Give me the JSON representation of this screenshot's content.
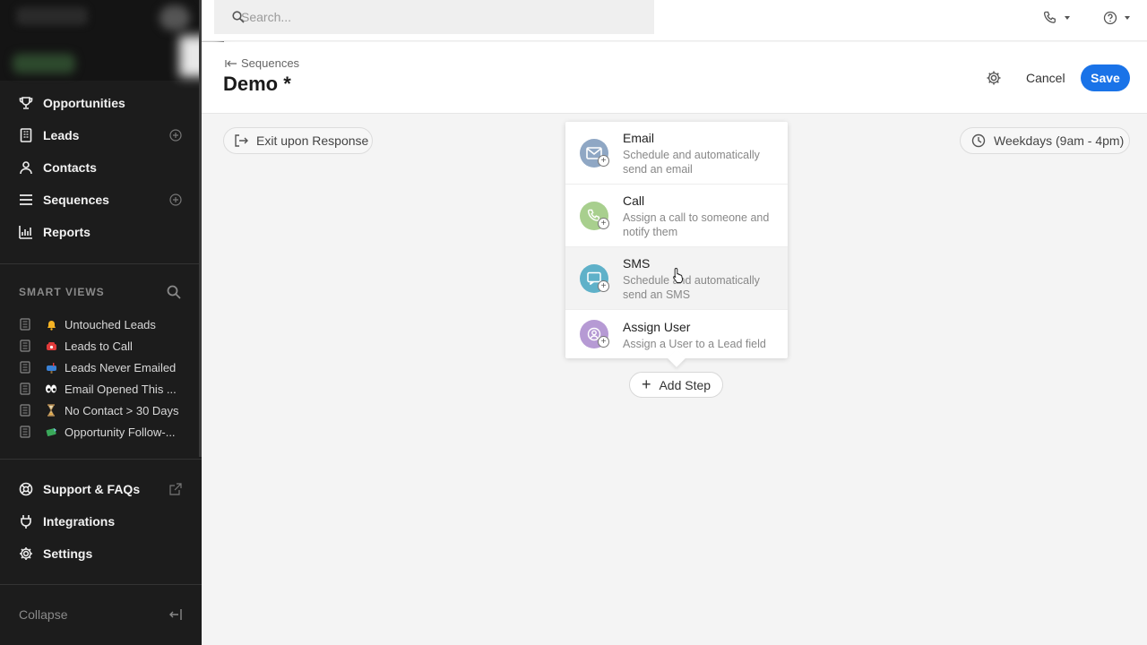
{
  "sidebar": {
    "nav_top": [
      {
        "label": "Opportunities",
        "icon": "trophy-icon"
      },
      {
        "label": "Leads",
        "icon": "building-icon",
        "add": true
      },
      {
        "label": "Contacts",
        "icon": "person-icon"
      },
      {
        "label": "Sequences",
        "icon": "list-icon",
        "add": true
      },
      {
        "label": "Reports",
        "icon": "chart-icon"
      }
    ],
    "smart_views_label": "SMART VIEWS",
    "smart_views": [
      {
        "label": "Untouched Leads",
        "emoji": "bell"
      },
      {
        "label": "Leads to Call",
        "emoji": "phone"
      },
      {
        "label": "Leads Never Emailed",
        "emoji": "mailbox"
      },
      {
        "label": "Email Opened This ...",
        "emoji": "eyes"
      },
      {
        "label": "No Contact > 30 Days",
        "emoji": "hourglass"
      },
      {
        "label": "Opportunity Follow-...",
        "emoji": "money"
      }
    ],
    "nav_bottom": [
      {
        "label": "Support & FAQs",
        "icon": "lifebuoy-icon"
      },
      {
        "label": "Integrations",
        "icon": "plug-icon"
      },
      {
        "label": "Settings",
        "icon": "gear-icon"
      }
    ],
    "collapse_label": "Collapse"
  },
  "topbar": {
    "search_placeholder": "Search..."
  },
  "header": {
    "breadcrumb": "Sequences",
    "title": "Demo *",
    "cancel_label": "Cancel",
    "save_label": "Save"
  },
  "canvas": {
    "exit_label": "Exit upon Response",
    "schedule_label": "Weekdays (9am - 4pm)",
    "add_step_label": "Add Step",
    "step_options": [
      {
        "title": "Email",
        "desc": "Schedule and automatically send an email",
        "color": "#8fa7c4"
      },
      {
        "title": "Call",
        "desc": "Assign a call to someone and notify them",
        "color": "#a8cf8e"
      },
      {
        "title": "SMS",
        "desc": "Schedule and automatically send an SMS",
        "color": "#5fb1c9"
      },
      {
        "title": "Assign User",
        "desc": "Assign a User to a Lead field",
        "color": "#b69ad4"
      }
    ]
  },
  "colors": {
    "accent": "#1a73e8",
    "sidebar_bg": "#1c1c1c"
  }
}
